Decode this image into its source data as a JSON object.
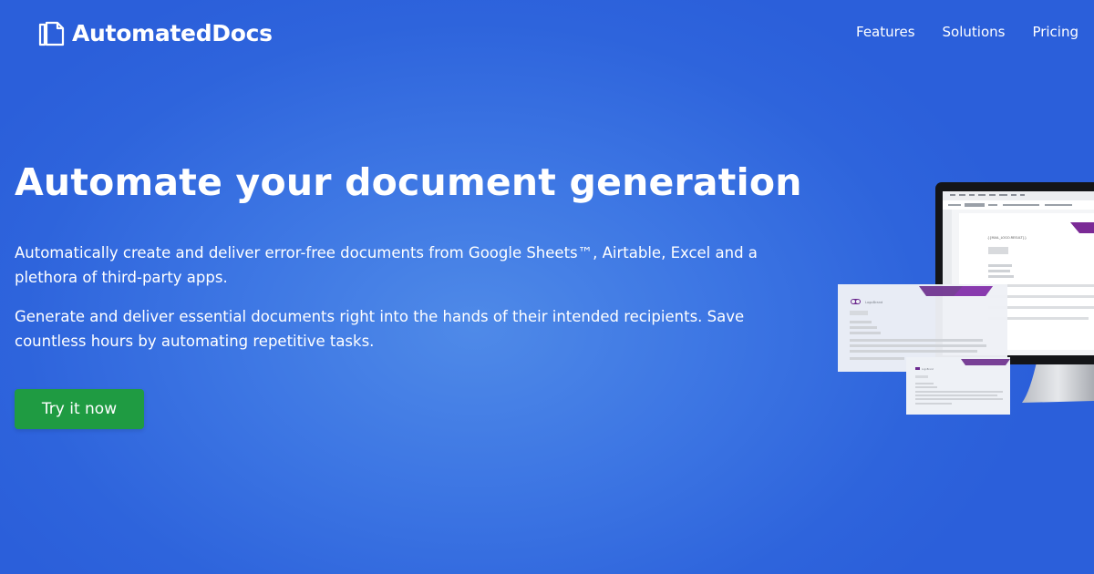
{
  "brand": {
    "name": "AutomatedDocs",
    "logo_icon": "documents-icon"
  },
  "nav": {
    "items": [
      {
        "label": "Features"
      },
      {
        "label": "Solutions"
      },
      {
        "label": "Pricing"
      }
    ]
  },
  "hero": {
    "title": "Automate your document generation",
    "paragraph_1": "Automatically create and deliver error-free documents from Google Sheets™, Airtable, Excel and a plethora of third-party apps.",
    "paragraph_2": "Generate and deliver essential documents right into the hands of their intended recipients. Save countless hours by automating repetitive tasks.",
    "cta_label": "Try it now"
  },
  "illustration": {
    "doc_brand_label": "LogoBrand",
    "editor_placeholder": "{{MAIL_LOGO.RESULT}}"
  },
  "colors": {
    "background": "#2e64dc",
    "cta": "#1f9b42",
    "accent_purple": "#7b2a96",
    "text": "#ffffff"
  }
}
